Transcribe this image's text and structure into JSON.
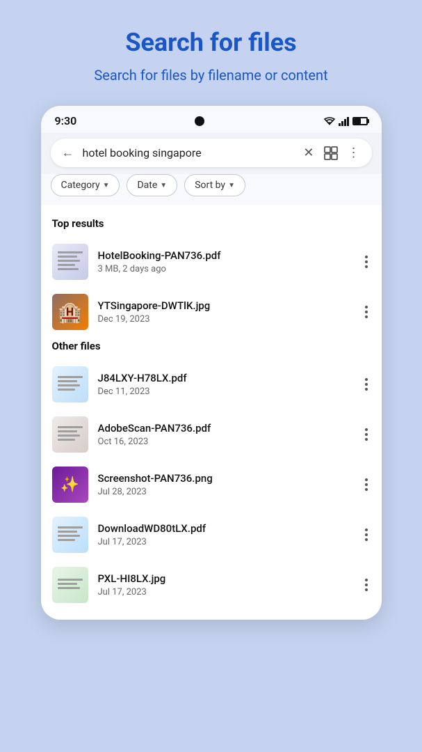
{
  "header": {
    "title": "Search for files",
    "subtitle": "Search for files by filename or content"
  },
  "status_bar": {
    "time": "9:30"
  },
  "search": {
    "query": "hotel booking singapore"
  },
  "filters": [
    {
      "label": "Category",
      "id": "category"
    },
    {
      "label": "Date",
      "id": "date"
    },
    {
      "label": "Sort by",
      "id": "sort_by"
    }
  ],
  "sections": [
    {
      "title": "Top results",
      "files": [
        {
          "name": "HotelBooking-PAN736.pdf",
          "meta": "3 MB, 2 days ago",
          "thumb_type": "pdf"
        },
        {
          "name": "YTSingapore-DWTlK.jpg",
          "meta": "Dec 19, 2023",
          "thumb_type": "hotel"
        }
      ]
    },
    {
      "title": "Other files",
      "files": [
        {
          "name": "J84LXY-H78LX.pdf",
          "meta": "Dec 11, 2023",
          "thumb_type": "doc"
        },
        {
          "name": "AdobeScan-PAN736.pdf",
          "meta": "Oct 16, 2023",
          "thumb_type": "scan"
        },
        {
          "name": "Screenshot-PAN736.png",
          "meta": "Jul 28, 2023",
          "thumb_type": "purple"
        },
        {
          "name": "DownloadWD80tLX.pdf",
          "meta": "Jul 17, 2023",
          "thumb_type": "doc2"
        },
        {
          "name": "PXL-HI8LX.jpg",
          "meta": "Jul 17, 2023",
          "thumb_type": "img"
        }
      ]
    }
  ]
}
